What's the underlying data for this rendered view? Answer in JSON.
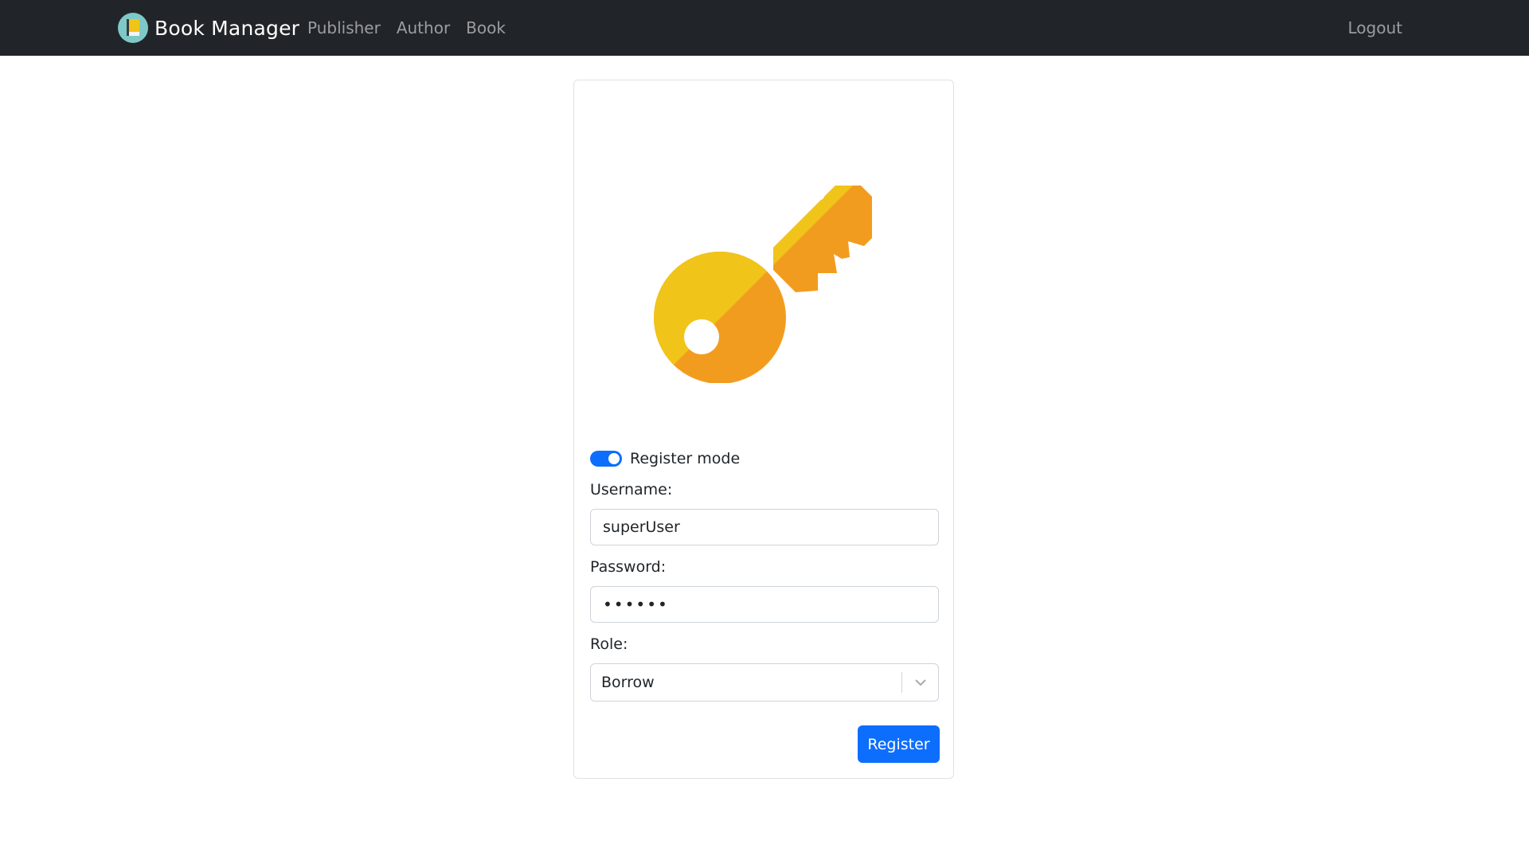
{
  "navbar": {
    "brand": "Book Manager",
    "links": [
      "Publisher",
      "Author",
      "Book"
    ],
    "logout": "Logout"
  },
  "form": {
    "mode_label": "Register mode",
    "mode_enabled": true,
    "username_label": "Username:",
    "username_value": "superUser",
    "password_label": "Password:",
    "password_value": "••••••",
    "role_label": "Role:",
    "role_value": "Borrow",
    "submit_label": "Register"
  },
  "icons": {
    "brand": "book-manager-logo-icon",
    "hero": "key-icon",
    "select": "chevron-down-icon"
  },
  "colors": {
    "navbar_bg": "#212529",
    "primary": "#0d6efd",
    "key_yellow": "#F0C419",
    "key_orange": "#F29C1F"
  }
}
